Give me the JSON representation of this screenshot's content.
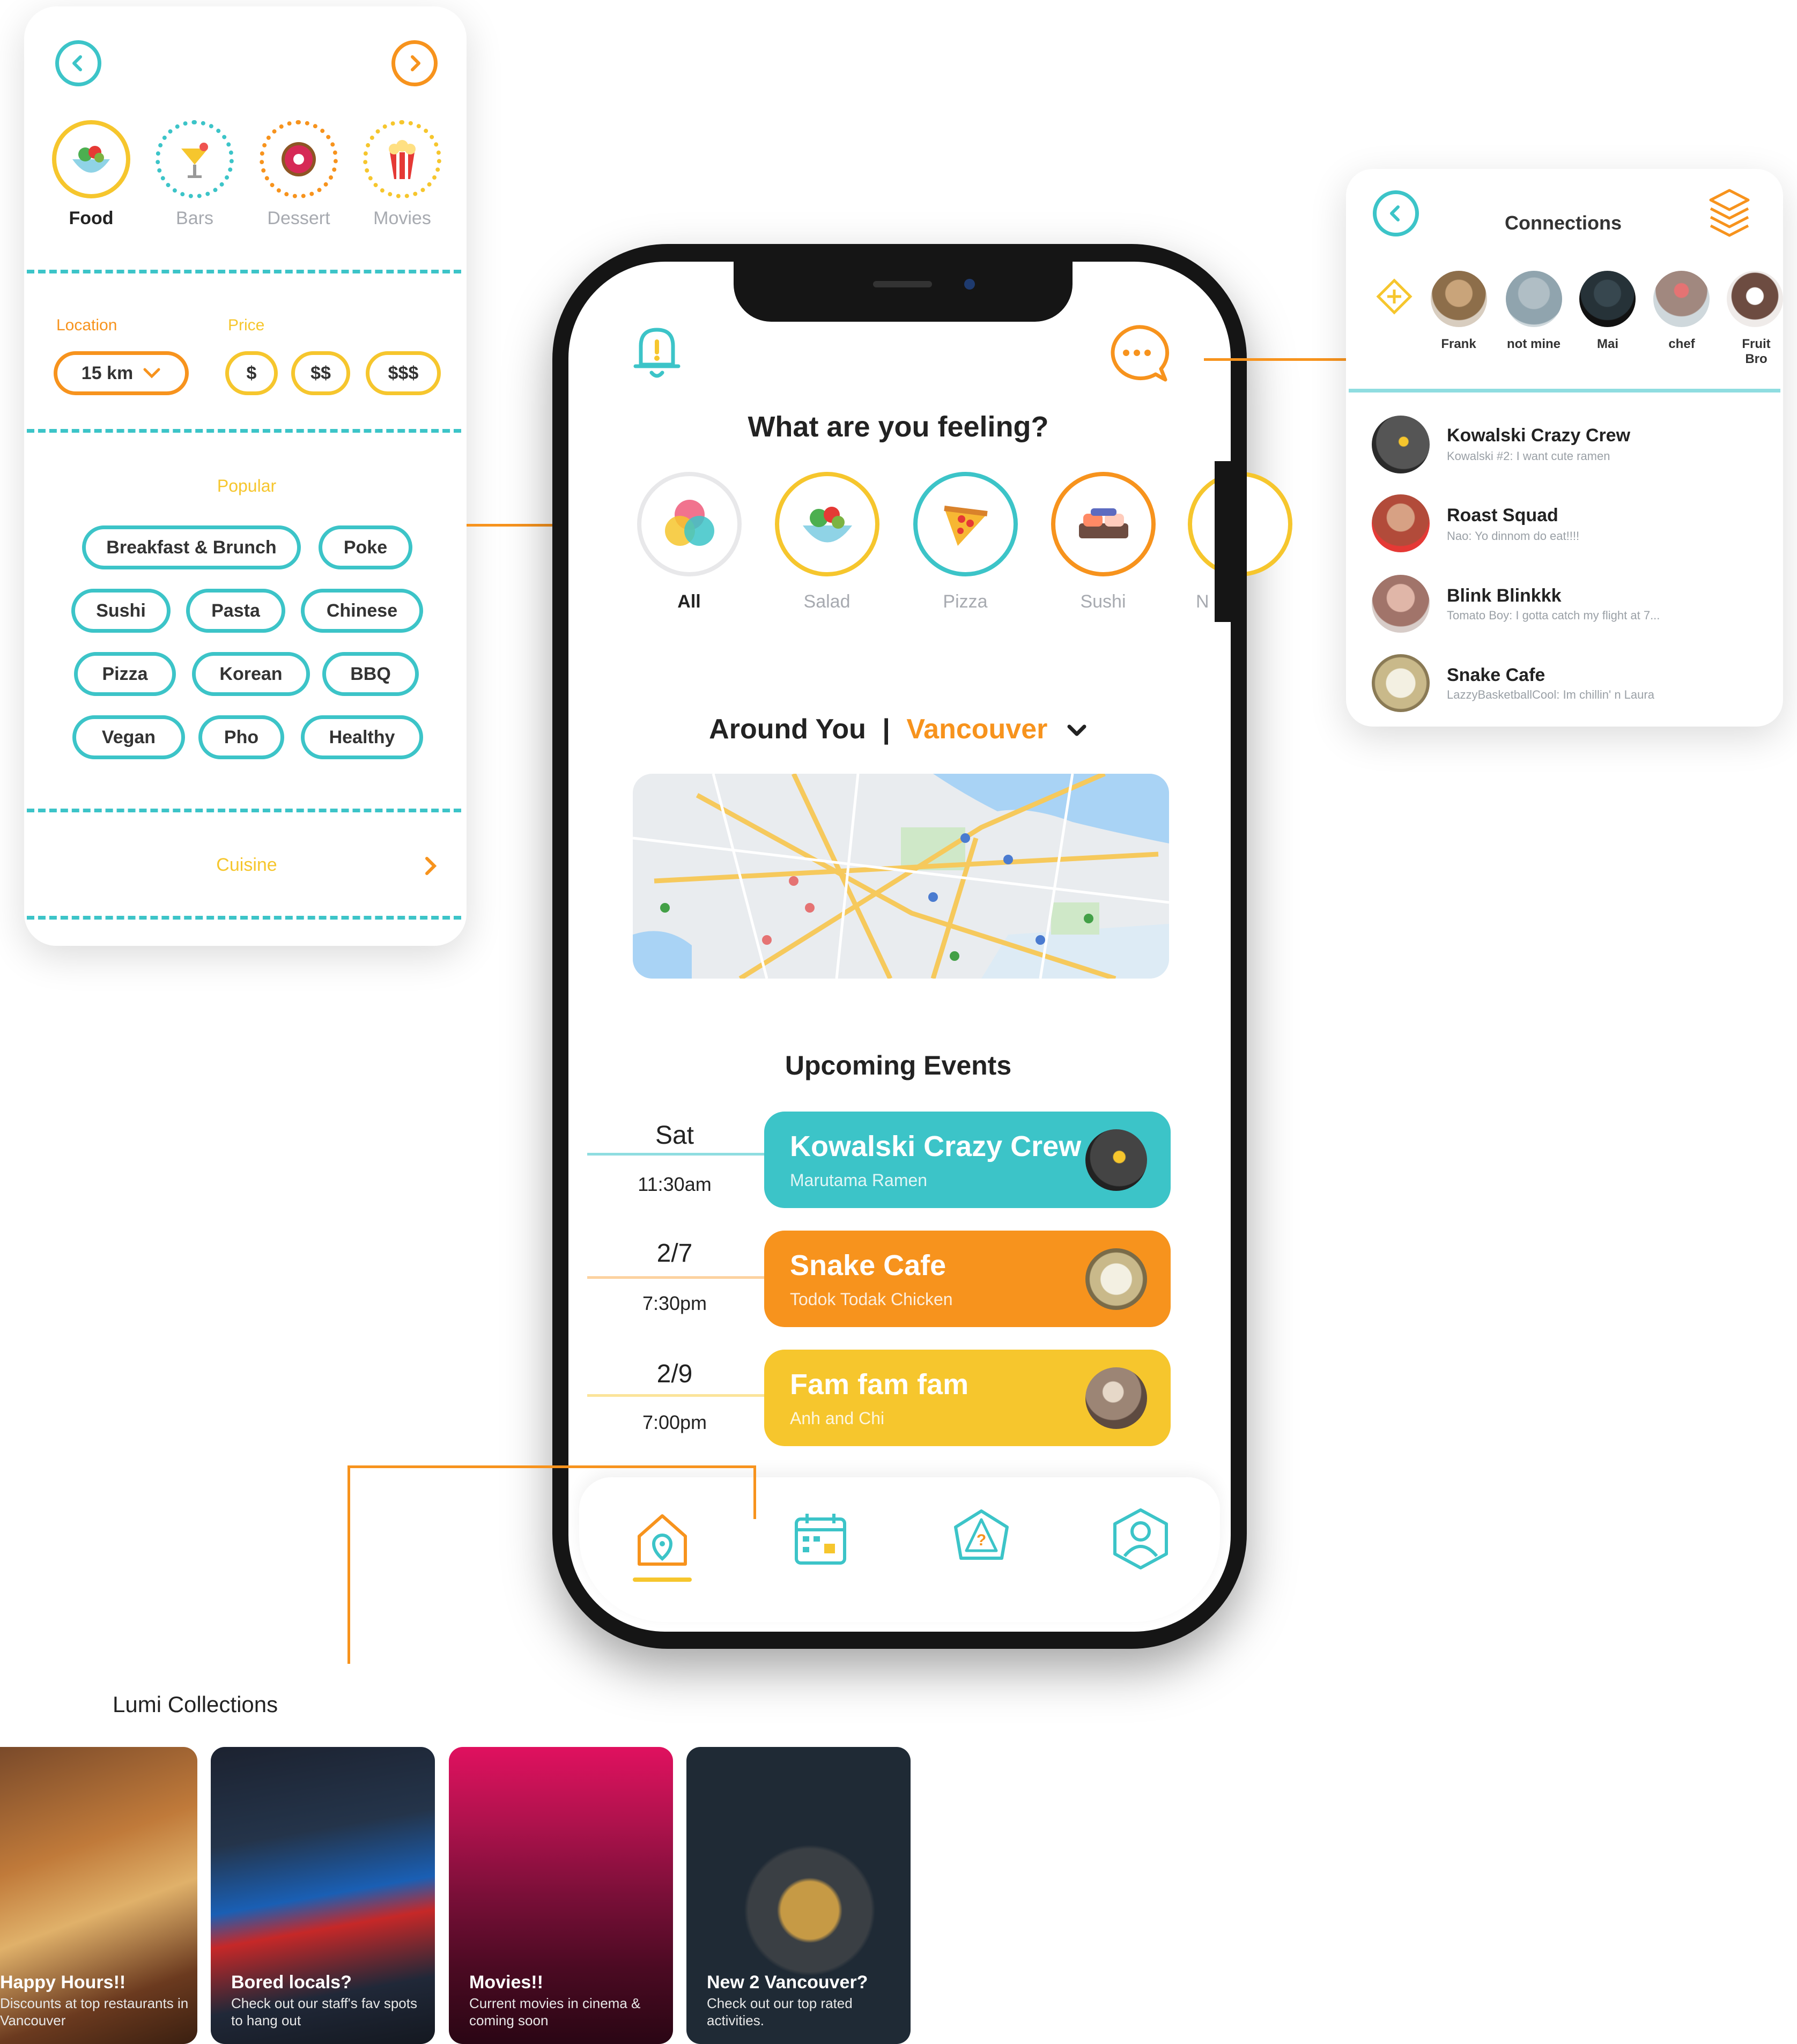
{
  "filter_panel": {
    "categories": [
      {
        "label": "Food",
        "icon": "salad-icon",
        "active": true
      },
      {
        "label": "Bars",
        "icon": "cocktail-icon",
        "active": false
      },
      {
        "label": "Dessert",
        "icon": "donut-icon",
        "active": false
      },
      {
        "label": "Movies",
        "icon": "popcorn-icon",
        "active": false
      }
    ],
    "location_label": "Location",
    "location_value": "15 km",
    "price_label": "Price",
    "price_options": [
      "$",
      "$$",
      "$$$"
    ],
    "popular_label": "Popular",
    "tags": [
      "Breakfast & Brunch",
      "Poke",
      "Sushi",
      "Pasta",
      "Chinese",
      "Pizza",
      "Korean",
      "BBQ",
      "Vegan",
      "Pho",
      "Healthy"
    ],
    "cuisine_label": "Cuisine"
  },
  "home": {
    "feeling_title": "What are you feeling?",
    "categories": [
      {
        "label": "All",
        "icon": "all-icon"
      },
      {
        "label": "Salad",
        "icon": "salad-icon"
      },
      {
        "label": "Pizza",
        "icon": "pizza-icon"
      },
      {
        "label": "Sushi",
        "icon": "sushi-icon"
      },
      {
        "label": "N",
        "icon": "partial-icon"
      }
    ],
    "around_label": "Around You",
    "around_separator": "|",
    "city": "Vancouver",
    "events_title": "Upcoming Events",
    "events": [
      {
        "date": "Sat",
        "time": "11:30am",
        "title": "Kowalski Crazy Crew",
        "subtitle": "Marutama Ramen",
        "color": "#3cc4c8"
      },
      {
        "date": "2/7",
        "time": "7:30pm",
        "title": "Snake Cafe",
        "subtitle": "Todok Todak Chicken",
        "color": "#f7931d"
      },
      {
        "date": "2/9",
        "time": "7:00pm",
        "title": "Fam fam fam",
        "subtitle": "Anh and Chi",
        "color": "#f6c62d"
      }
    ],
    "nav": [
      "home-icon",
      "calendar-icon",
      "explore-icon",
      "profile-icon"
    ]
  },
  "connections": {
    "title": "Connections",
    "friends": [
      {
        "name": "Frank"
      },
      {
        "name": "not mine"
      },
      {
        "name": "Mai"
      },
      {
        "name": "chef"
      },
      {
        "name": "Fruit Bro"
      }
    ],
    "conversations": [
      {
        "name": "Kowalski Crazy Crew",
        "message": "Kowalski #2: I want cute ramen"
      },
      {
        "name": "Roast Squad",
        "message": "Nao: Yo dinnom do eat!!!!"
      },
      {
        "name": "Blink Blinkkk",
        "message": "Tomato Boy: I gotta catch my flight at 7..."
      },
      {
        "name": "Snake Cafe",
        "message": "LazzyBasketballCool: Im chillin' n Laura"
      }
    ]
  },
  "collections": {
    "title": "Lumi Collections",
    "items": [
      {
        "title": "Happy Hours!!",
        "subtitle": "Discounts at top restaurants in Vancouver"
      },
      {
        "title": "Bored locals?",
        "subtitle": "Check out our staff's fav spots to hang out"
      },
      {
        "title": "Movies!!",
        "subtitle": "Current movies in cinema & coming soon"
      },
      {
        "title": "New 2 Vancouver?",
        "subtitle": "Check out our top rated activities."
      }
    ]
  },
  "colors": {
    "teal": "#3cc4c8",
    "orange": "#f7931d",
    "yellow": "#f6c62d"
  }
}
